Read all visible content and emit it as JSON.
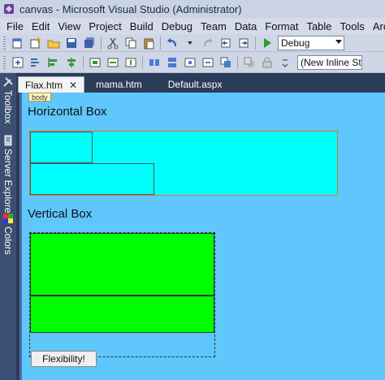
{
  "window": {
    "title": "canvas - Microsoft Visual Studio (Administrator)"
  },
  "menubar": {
    "items": [
      "File",
      "Edit",
      "View",
      "Project",
      "Build",
      "Debug",
      "Team",
      "Data",
      "Format",
      "Table",
      "Tools",
      "Arch"
    ]
  },
  "toolbar": {
    "config_combo": "Debug",
    "style_combo": "(New Inline Sty"
  },
  "sidebar": {
    "panels": [
      "Toolbox",
      "Server Explorer",
      "Colors"
    ]
  },
  "tabs": [
    {
      "label": "Flax.htm",
      "active": true
    },
    {
      "label": "mama.htm"
    },
    {
      "label": "Default.aspx"
    }
  ],
  "editor": {
    "tag_label": "body",
    "horizontal_heading": "Horizontal Box",
    "vertical_heading": "Vertical Box",
    "button_label": "Flexibility!",
    "colors": {
      "cyan": "#00ffff",
      "green": "#00ff00",
      "canvas": "#5fc7fb"
    }
  }
}
